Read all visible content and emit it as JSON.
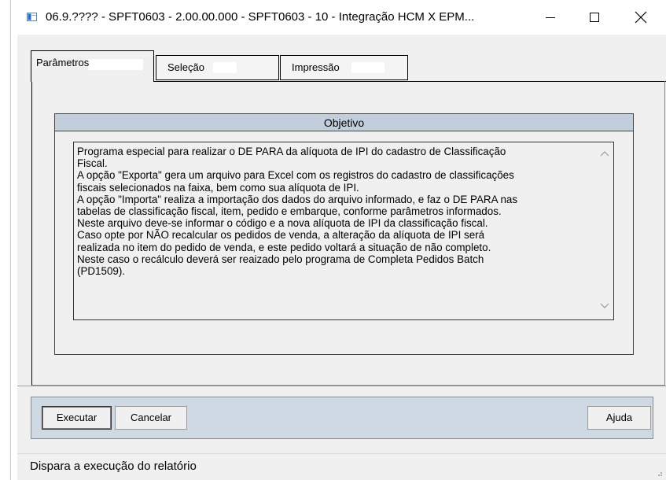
{
  "window": {
    "title": "06.9.???? - SPFT0603 - 2.00.00.000 - SPFT0603 - 10 - Integração HCM X EPM..."
  },
  "icons": {
    "app": "app-icon",
    "minimize": "minimize-icon",
    "maximize": "maximize-icon",
    "close": "close-icon",
    "scroll_up": "scroll-up-icon",
    "scroll_down": "scroll-down-icon",
    "grip": "resize-grip-icon"
  },
  "tabs": [
    {
      "label": "Parâmetros",
      "active": true
    },
    {
      "label": "Seleção",
      "active": false
    },
    {
      "label": "Impressão",
      "active": false
    }
  ],
  "objective": {
    "title": "Objetivo",
    "lines": [
      "Programa especial para realizar o DE PARA da alíquota de IPI do cadastro de Classificação",
      "Fiscal.",
      "A opção \"Exporta\" gera um arquivo para Excel com os registros do cadastro de classificações",
      "fiscais selecionados na faixa, bem como sua alíquota de IPI.",
      "A opção \"Importa\" realiza a importação dos dados do arquivo informado, e faz o DE PARA nas",
      "tabelas de classificação fiscal, item, pedido e embarque, conforme parâmetros informados.",
      "Neste arquivo deve-se informar o código e a nova alíquota  de IPI da classificação fiscal.",
      "Caso opte por NÃO recalcular os pedidos de venda, a alteração da alíquota de IPI será",
      "realizada no item do pedido de venda, e este pedido voltará a situação de não completo.",
      "Neste caso o recálculo deverá ser reaizado pelo programa de Completa Pedidos Batch",
      "(PD1509)."
    ]
  },
  "buttons": {
    "execute": "Executar",
    "cancel": "Cancelar",
    "help": "Ajuda"
  },
  "status": {
    "text": "Dispara a execução do relatório"
  }
}
